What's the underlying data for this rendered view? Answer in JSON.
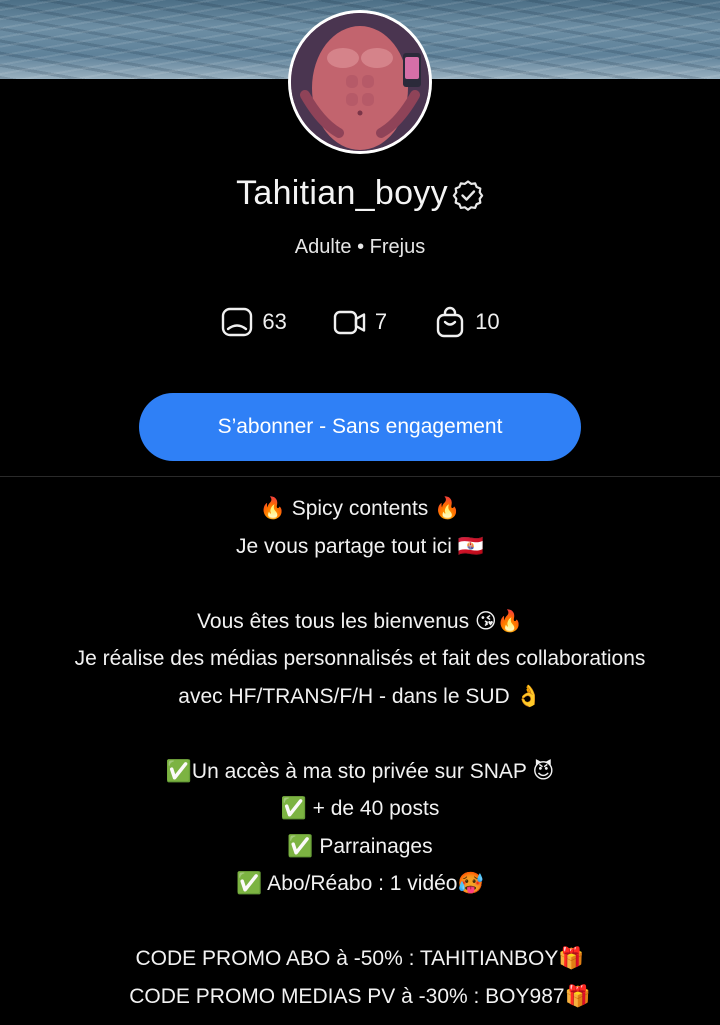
{
  "profile": {
    "username": "Tahitian_boyy",
    "meta": "Adulte • Frejus",
    "verified_icon": "verified-badge-icon",
    "avatar_icon": "profile-photo"
  },
  "stats": {
    "photos": {
      "icon": "photo-icon",
      "count": "63"
    },
    "videos": {
      "icon": "video-camera-icon",
      "count": "7"
    },
    "products": {
      "icon": "shopping-bag-icon",
      "count": "10"
    }
  },
  "actions": {
    "subscribe_label": "S’abonner - Sans engagement",
    "accent": "#2f80f6"
  },
  "bio": {
    "lines": [
      "🔥 Spicy contents 🔥",
      "Je vous partage tout ici 🇵🇫",
      "",
      "Vous êtes tous les bienvenus 😘🔥",
      "Je réalise des médias personnalisés et fait des collaborations",
      "avec HF/TRANS/F/H - dans le SUD 👌",
      "",
      "✅Un accès à ma sto privée sur SNAP 😈",
      "✅ + de 40 posts",
      "✅ Parrainages",
      "✅ Abo/Réabo : 1 vidéo🥵",
      "",
      "CODE PROMO ABO à -50% : TAHITIANBOY🎁",
      "CODE PROMO MEDIAS PV à -30% : BOY987🎁"
    ]
  }
}
